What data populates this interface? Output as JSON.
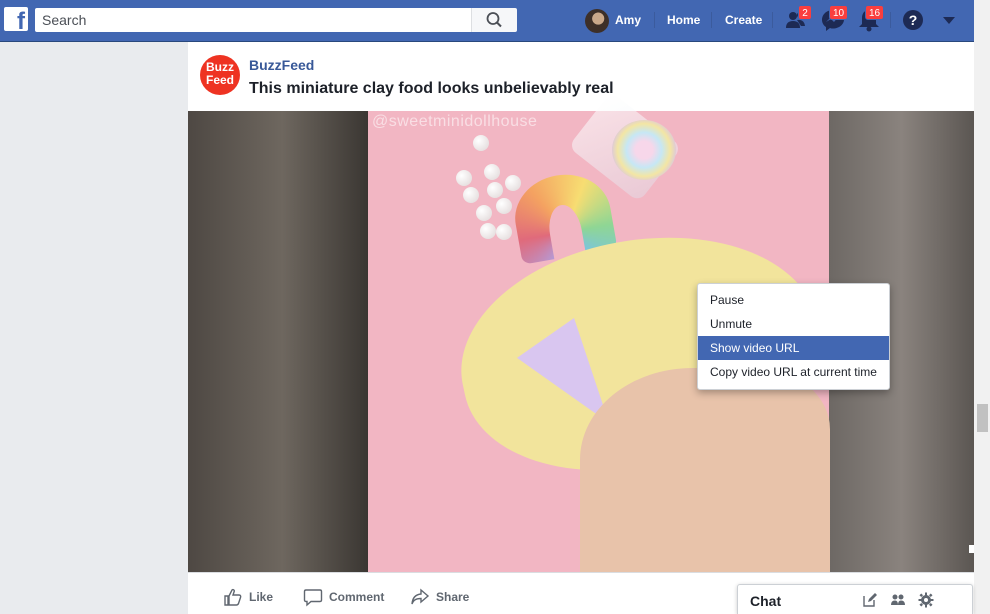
{
  "topbar": {
    "search_placeholder": "Search",
    "user_name": "Amy",
    "home_label": "Home",
    "create_label": "Create",
    "friend_requests_badge": "2",
    "messages_badge": "10",
    "notifications_badge": "16",
    "help_glyph": "?"
  },
  "post": {
    "page_name": "BuzzFeed",
    "page_logo_text_1": "Buzz",
    "page_logo_text_2": "Feed",
    "title": "This miniature clay food looks unbelievably real",
    "video_watermark": "@sweetminidollhouse"
  },
  "context_menu": {
    "items": [
      {
        "label": "Pause"
      },
      {
        "label": "Unmute"
      },
      {
        "label": "Show video URL",
        "highlighted": true
      },
      {
        "label": "Copy video URL at current time"
      }
    ]
  },
  "actions": {
    "like": "Like",
    "comment": "Comment",
    "share": "Share",
    "truncated": "omm"
  },
  "chat": {
    "label": "Chat"
  },
  "colors": {
    "brand_blue": "#4267b2",
    "badge_red": "#fa3e3e",
    "buzzfeed_red": "#ee3322",
    "menu_highlight": "#4267b2"
  }
}
